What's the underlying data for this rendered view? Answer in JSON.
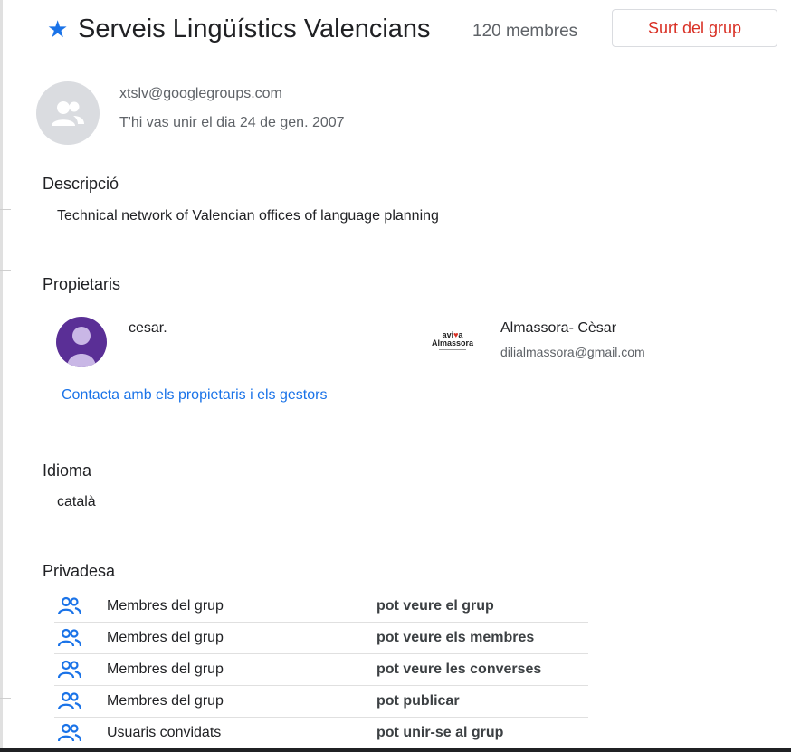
{
  "header": {
    "star_icon": "star-icon",
    "title": "Serveis Lingüístics Valencians",
    "member_count": "120 membres",
    "leave_button": "Surt del grup",
    "accent_color": "#1a73e8",
    "danger_color": "#d93025"
  },
  "group": {
    "avatar_icon": "group-icon",
    "email": "xtslv@googlegroups.com",
    "joined": "T'hi vas unir el dia 24 de gen. 2007"
  },
  "description": {
    "heading": "Descripció",
    "text": "Technical network of Valencian offices of language planning"
  },
  "owners": {
    "heading": "Propietaris",
    "items": [
      {
        "name": "cesar.",
        "email": ""
      },
      {
        "name": "Almassora- Cèsar",
        "email": "dilialmassora@gmail.com",
        "logo_text": "aviva Almassora"
      }
    ],
    "contact_link": "Contacta amb els propietaris i els gestors"
  },
  "language": {
    "heading": "Idioma",
    "value": "català"
  },
  "privacy": {
    "heading": "Privadesa",
    "rows": [
      {
        "who": "Membres del grup",
        "permission": "pot veure el grup"
      },
      {
        "who": "Membres del grup",
        "permission": "pot veure els membres"
      },
      {
        "who": "Membres del grup",
        "permission": "pot veure les converses"
      },
      {
        "who": "Membres del grup",
        "permission": "pot publicar"
      },
      {
        "who": "Usuaris convidats",
        "permission": "pot unir-se al grup"
      }
    ]
  }
}
